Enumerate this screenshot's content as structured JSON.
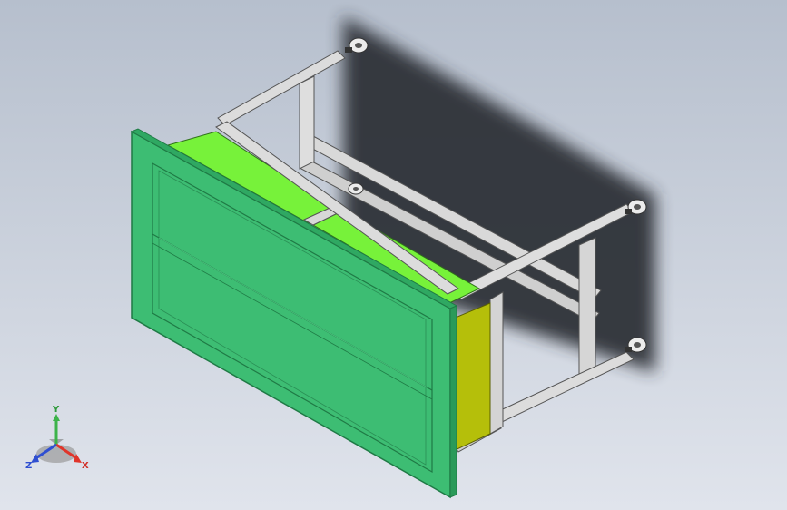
{
  "viewport": {
    "background_top": "#c4cbd7",
    "background_bottom": "#dde2ea"
  },
  "model": {
    "panel_color": "#3dbd73",
    "panel_edge_color": "#1f7a45",
    "drawer_top_color": "#77f23a",
    "side_panel_color": "#b5bf0a",
    "frame_color": "#d9d9d9",
    "frame_edge_color": "#5a5a5a",
    "shadow_color": "#2f3338"
  },
  "triad": {
    "x_label": "X",
    "y_label": "Y",
    "z_label": "Z",
    "x_color": "#e0352b",
    "y_color": "#3cb34a",
    "z_color": "#2f4fd1"
  }
}
